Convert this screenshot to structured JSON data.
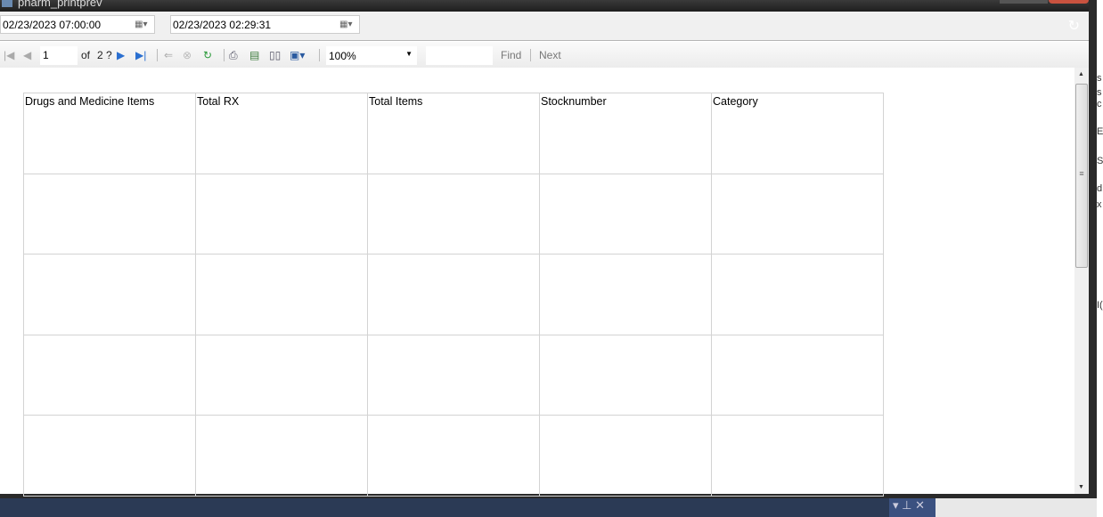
{
  "window": {
    "title": "pharm_printprev"
  },
  "filters": {
    "start_date": "02/23/2023 07:00:00",
    "end_date": "02/23/2023 02:29:31"
  },
  "toolbar": {
    "page": "1",
    "of_label": "of",
    "total_pages": "2 ?",
    "zoom": "100%",
    "find_value": "",
    "find_label": "Find",
    "next_label": "Next"
  },
  "report": {
    "columns": [
      "Drugs and Medicine Items",
      "Total RX",
      "Total Items",
      "Stocknumber",
      "Category"
    ],
    "empty_rows": 4
  },
  "background": {
    "snippets": [
      "s",
      "s",
      "c",
      "E",
      "S",
      "d",
      "x",
      "I("
    ]
  }
}
